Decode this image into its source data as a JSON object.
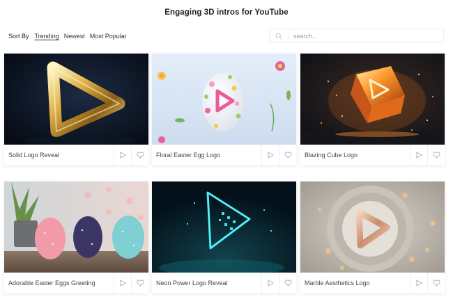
{
  "page": {
    "title": "Engaging 3D intros for YouTube"
  },
  "sort": {
    "label": "Sort By",
    "options": [
      {
        "label": "Trending",
        "active": true
      },
      {
        "label": "Newest",
        "active": false
      },
      {
        "label": "Most Popular",
        "active": false
      }
    ]
  },
  "search": {
    "placeholder": "search..."
  },
  "cards": [
    {
      "title": "Solid Logo Reveal"
    },
    {
      "title": "Floral Easter Egg Logo"
    },
    {
      "title": "Blazing Cube Logo"
    },
    {
      "title": "Adorable Easter Eggs Greeting"
    },
    {
      "title": "Neon Power Logo Reveal"
    },
    {
      "title": "Marble Aesthetics Logo"
    }
  ],
  "icons": {
    "play": "play-icon",
    "favorite": "heart-icon",
    "search": "search-icon"
  },
  "colors": {
    "icon": "#a9b3c6",
    "text": "#444444",
    "border": "#eef0f3"
  }
}
